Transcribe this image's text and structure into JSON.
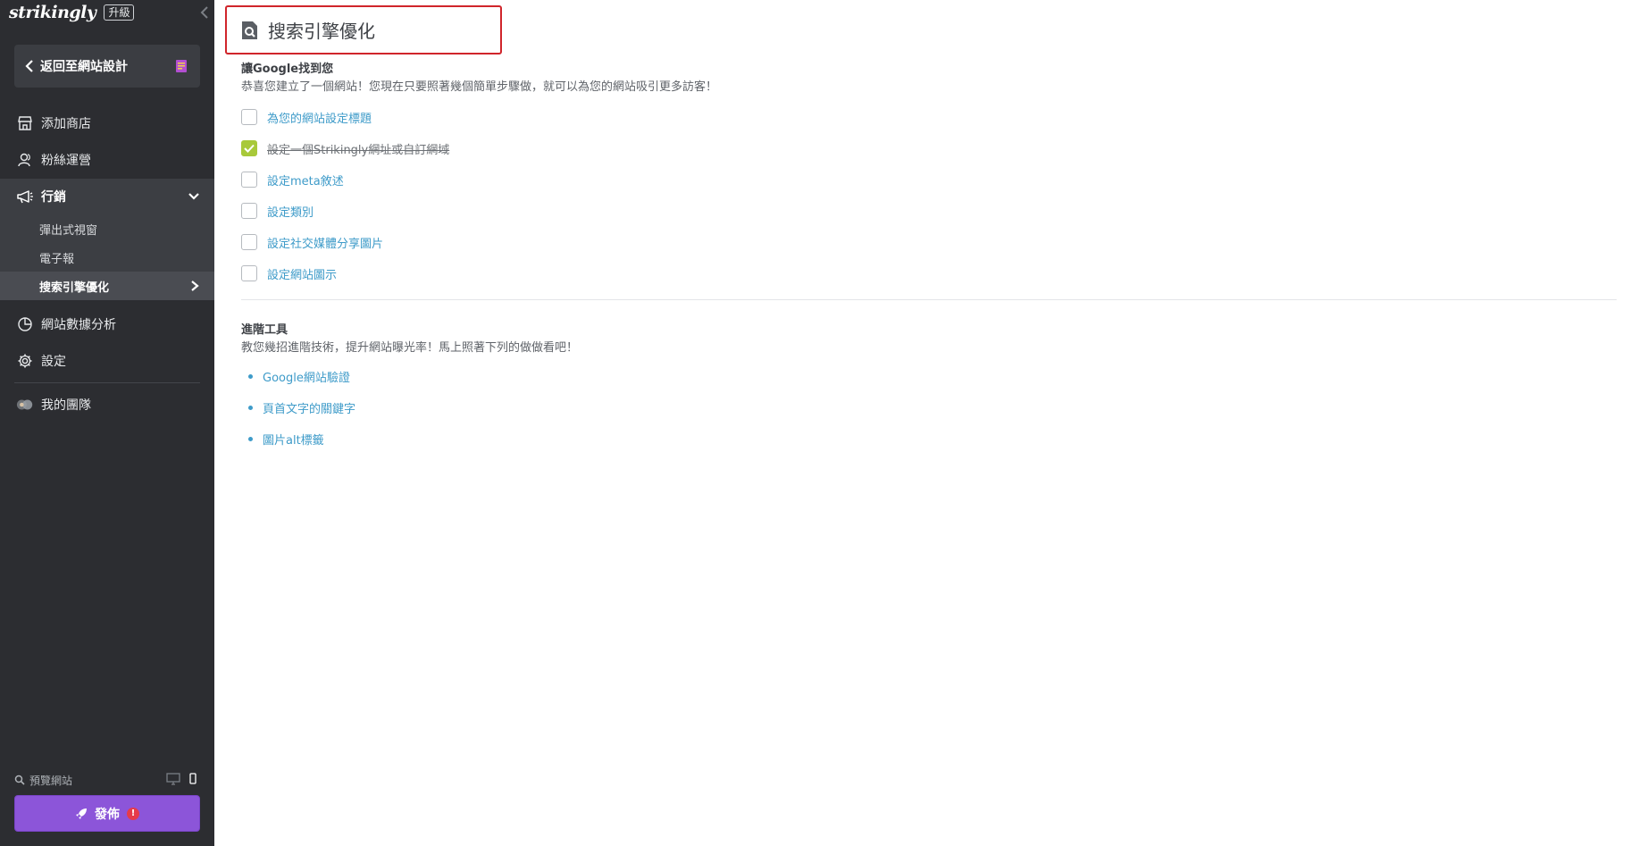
{
  "brand": {
    "logo": "strikingly",
    "upgrade": "升級"
  },
  "sidebar": {
    "back_label": "返回至網站設計",
    "items": [
      {
        "label": "添加商店",
        "icon": "store-icon"
      },
      {
        "label": "粉絲運營",
        "icon": "users-icon"
      },
      {
        "label": "行銷",
        "icon": "megaphone-icon"
      },
      {
        "label": "網站數據分析",
        "icon": "pie-chart-icon"
      },
      {
        "label": "設定",
        "icon": "gear-icon"
      },
      {
        "label": "我的團隊",
        "icon": "team-icon"
      }
    ],
    "sub_items": [
      {
        "label": "彈出式視窗"
      },
      {
        "label": "電子報"
      },
      {
        "label": "搜索引擎優化"
      }
    ],
    "preview_label": "預覽網站",
    "publish_label": "發佈",
    "publish_alert": "!"
  },
  "header": {
    "title": "搜索引擎優化",
    "icon": "search-page-icon"
  },
  "seo": {
    "section_title": "讓Google找到您",
    "section_desc": "恭喜您建立了一個網站！您現在只要照著幾個簡單步驟做，就可以為您的網站吸引更多訪客！",
    "checklist": [
      {
        "label": "為您的網站設定標題",
        "checked": false
      },
      {
        "label": "設定一個Strikingly網址或自訂網域",
        "checked": true
      },
      {
        "label": "設定meta敘述",
        "checked": false
      },
      {
        "label": "設定類別",
        "checked": false
      },
      {
        "label": "設定社交媒體分享圖片",
        "checked": false
      },
      {
        "label": "設定網站圖示",
        "checked": false
      }
    ]
  },
  "advanced": {
    "title": "進階工具",
    "desc": "教您幾招進階技術，提升網站曝光率！馬上照著下列的做做看吧！",
    "links": [
      {
        "label": "Google網站驗證"
      },
      {
        "label": "頁首文字的關鍵字"
      },
      {
        "label": "圖片alt標籤"
      }
    ]
  },
  "colors": {
    "sidebar_bg": "#2c2d31",
    "accent_purple": "#8c55d9",
    "link_blue": "#3e9bc9",
    "check_green": "#a8c93a",
    "highlight_red": "#d0252b"
  }
}
